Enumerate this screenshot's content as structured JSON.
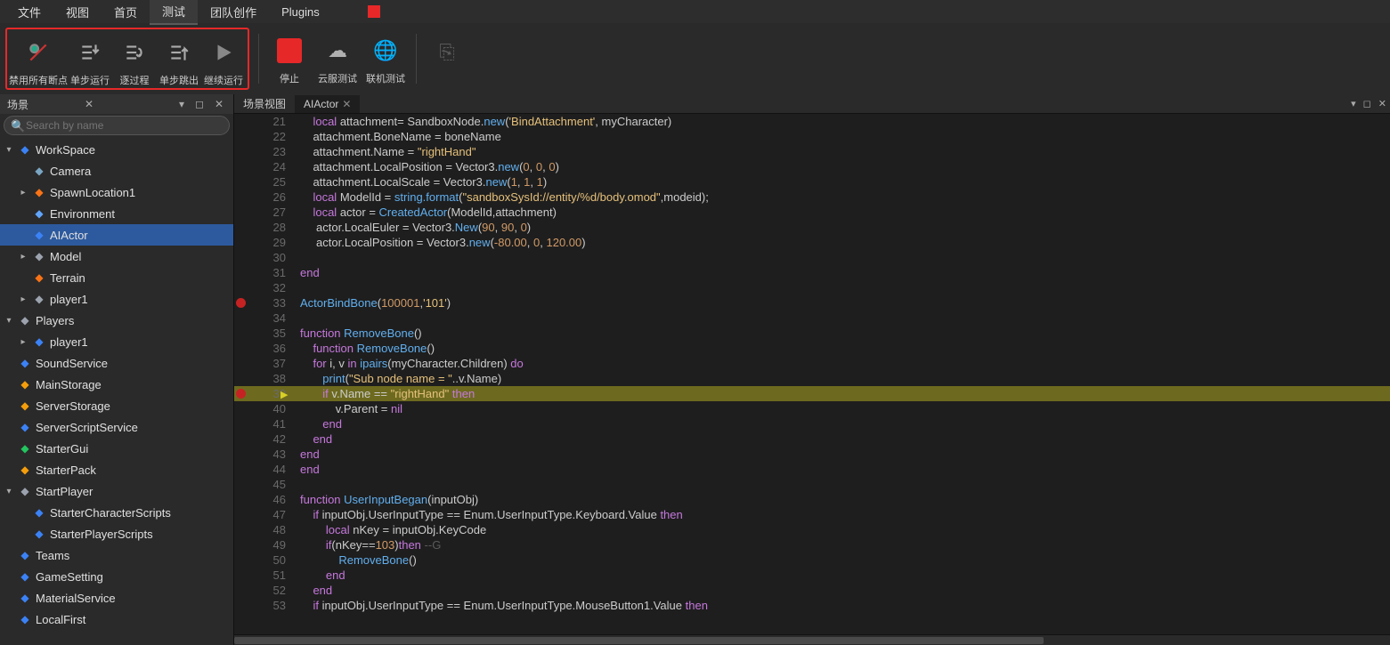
{
  "menubar": {
    "items": [
      "文件",
      "视图",
      "首页",
      "测试",
      "团队创作",
      "Plugins"
    ],
    "activeIndex": 3
  },
  "toolbar": {
    "debug": [
      {
        "name": "disable-breakpoints",
        "label": "禁用所有断点",
        "icon": "bp"
      },
      {
        "name": "step-run",
        "label": "单步运行",
        "icon": "stepinto"
      },
      {
        "name": "step-over",
        "label": "逐过程",
        "icon": "stepover"
      },
      {
        "name": "step-out",
        "label": "单步跳出",
        "icon": "stepout"
      },
      {
        "name": "continue",
        "label": "继续运行",
        "icon": "play"
      }
    ],
    "stop": {
      "label": "停止"
    },
    "cloud": {
      "label": "云服测试"
    },
    "net": {
      "label": "联机测试"
    }
  },
  "scenePanel": {
    "title": "场景",
    "search_placeholder": "Search by name"
  },
  "tree": [
    {
      "label": "WorkSpace",
      "icon": "globe",
      "arrow": "down",
      "indent": 0,
      "color": "#3b82f6"
    },
    {
      "label": "Camera",
      "icon": "cam",
      "indent": 1,
      "color": "#7aa6c4"
    },
    {
      "label": "SpawnLocation1",
      "icon": "spawn",
      "arrow": "right",
      "indent": 1,
      "color": "#f97316"
    },
    {
      "label": "Environment",
      "icon": "env",
      "indent": 1,
      "color": "#60a5fa"
    },
    {
      "label": "AIActor",
      "icon": "script",
      "indent": 1,
      "selected": true,
      "color": "#3b82f6"
    },
    {
      "label": "Model",
      "icon": "model",
      "arrow": "right",
      "indent": 1,
      "color": "#9ca3af"
    },
    {
      "label": "Terrain",
      "icon": "terrain",
      "indent": 1,
      "color": "#f97316"
    },
    {
      "label": "player1",
      "icon": "player",
      "arrow": "right",
      "indent": 1,
      "color": "#9ca3af"
    },
    {
      "label": "Players",
      "icon": "players",
      "arrow": "down",
      "indent": 0,
      "color": "#9ca3af"
    },
    {
      "label": "player1",
      "icon": "player",
      "arrow": "right",
      "indent": 1,
      "color": "#3b82f6"
    },
    {
      "label": "SoundService",
      "icon": "sound",
      "indent": 0,
      "color": "#3b82f6"
    },
    {
      "label": "MainStorage",
      "icon": "storage",
      "indent": 0,
      "color": "#f59e0b"
    },
    {
      "label": "ServerStorage",
      "icon": "storage",
      "indent": 0,
      "color": "#f59e0b"
    },
    {
      "label": "ServerScriptService",
      "icon": "script",
      "indent": 0,
      "color": "#3b82f6"
    },
    {
      "label": "StarterGui",
      "icon": "gui",
      "indent": 0,
      "color": "#22c55e"
    },
    {
      "label": "StarterPack",
      "icon": "pack",
      "indent": 0,
      "color": "#f59e0b"
    },
    {
      "label": "StartPlayer",
      "icon": "player",
      "arrow": "down",
      "indent": 0,
      "color": "#9ca3af"
    },
    {
      "label": "StarterCharacterScripts",
      "icon": "script",
      "indent": 1,
      "color": "#3b82f6"
    },
    {
      "label": "StarterPlayerScripts",
      "icon": "script",
      "indent": 1,
      "color": "#3b82f6"
    },
    {
      "label": "Teams",
      "icon": "teams",
      "indent": 0,
      "color": "#3b82f6"
    },
    {
      "label": "GameSetting",
      "icon": "gear",
      "indent": 0,
      "color": "#3b82f6"
    },
    {
      "label": "MaterialService",
      "icon": "mat",
      "indent": 0,
      "color": "#3b82f6"
    },
    {
      "label": "LocalFirst",
      "icon": "local",
      "indent": 0,
      "color": "#3b82f6"
    }
  ],
  "editorTabs": {
    "sceneView": "场景视图",
    "activeTab": "AIActor"
  },
  "code": [
    {
      "n": 21,
      "t": [
        [
          "",
          "    "
        ],
        [
          "kw",
          "local"
        ],
        [
          "",
          " attachment= SandboxNode."
        ],
        [
          "fn",
          "new"
        ],
        [
          "",
          "("
        ],
        [
          "str",
          "'BindAttachment'"
        ],
        [
          "",
          ", myCharacter)"
        ]
      ]
    },
    {
      "n": 22,
      "t": [
        [
          "",
          "    attachment.BoneName = boneName"
        ]
      ]
    },
    {
      "n": 23,
      "t": [
        [
          "",
          "    attachment.Name = "
        ],
        [
          "str",
          "\"rightHand\""
        ]
      ]
    },
    {
      "n": 24,
      "t": [
        [
          "",
          "    attachment.LocalPosition = Vector3."
        ],
        [
          "fn",
          "new"
        ],
        [
          "",
          "("
        ],
        [
          "num",
          "0"
        ],
        [
          "",
          ", "
        ],
        [
          "num",
          "0"
        ],
        [
          "",
          ", "
        ],
        [
          "num",
          "0"
        ],
        [
          "",
          ")"
        ]
      ]
    },
    {
      "n": 25,
      "t": [
        [
          "",
          "    attachment.LocalScale = Vector3."
        ],
        [
          "fn",
          "new"
        ],
        [
          "",
          "("
        ],
        [
          "num",
          "1"
        ],
        [
          "",
          ", "
        ],
        [
          "num",
          "1"
        ],
        [
          "",
          ", "
        ],
        [
          "num",
          "1"
        ],
        [
          "",
          ")"
        ]
      ]
    },
    {
      "n": 26,
      "t": [
        [
          "",
          "    "
        ],
        [
          "kw",
          "local"
        ],
        [
          "",
          " ModelId = "
        ],
        [
          "fn",
          "string.format"
        ],
        [
          "",
          "("
        ],
        [
          "str",
          "\"sandboxSysId://entity/%d/body.omod\""
        ],
        [
          "",
          ",modeid);"
        ]
      ]
    },
    {
      "n": 27,
      "t": [
        [
          "",
          "    "
        ],
        [
          "kw",
          "local"
        ],
        [
          "",
          " actor = "
        ],
        [
          "fn",
          "CreatedActor"
        ],
        [
          "",
          "(ModelId,attachment)"
        ]
      ]
    },
    {
      "n": 28,
      "t": [
        [
          "",
          "     actor.LocalEuler = Vector3."
        ],
        [
          "fn",
          "New"
        ],
        [
          "",
          "("
        ],
        [
          "num",
          "90"
        ],
        [
          "",
          ", "
        ],
        [
          "num",
          "90"
        ],
        [
          "",
          ", "
        ],
        [
          "num",
          "0"
        ],
        [
          "",
          ")"
        ]
      ]
    },
    {
      "n": 29,
      "t": [
        [
          "",
          "     actor.LocalPosition = Vector3."
        ],
        [
          "fn",
          "new"
        ],
        [
          "",
          "("
        ],
        [
          "num",
          "-80.00"
        ],
        [
          "",
          ", "
        ],
        [
          "num",
          "0"
        ],
        [
          "",
          ", "
        ],
        [
          "num",
          "120.00"
        ],
        [
          "",
          ")"
        ]
      ]
    },
    {
      "n": 30,
      "t": [
        [
          "",
          ""
        ]
      ]
    },
    {
      "n": 31,
      "t": [
        [
          "kw",
          "end"
        ]
      ]
    },
    {
      "n": 32,
      "t": [
        [
          "",
          ""
        ]
      ]
    },
    {
      "n": 33,
      "bp": true,
      "t": [
        [
          "fn",
          "ActorBindBone"
        ],
        [
          "",
          "("
        ],
        [
          "num",
          "100001"
        ],
        [
          "",
          ","
        ],
        [
          "str",
          "'101'"
        ],
        [
          "",
          ")"
        ]
      ]
    },
    {
      "n": 34,
      "t": [
        [
          "",
          ""
        ]
      ]
    },
    {
      "n": 35,
      "t": [
        [
          "kw",
          "function"
        ],
        [
          "",
          " "
        ],
        [
          "fn",
          "RemoveBone"
        ],
        [
          "",
          "()"
        ]
      ]
    },
    {
      "n": 36,
      "t": [
        [
          "",
          "    "
        ],
        [
          "kw",
          "function"
        ],
        [
          "",
          " "
        ],
        [
          "fn",
          "RemoveBone"
        ],
        [
          "",
          "()"
        ]
      ]
    },
    {
      "n": 37,
      "t": [
        [
          "",
          "    "
        ],
        [
          "kw",
          "for"
        ],
        [
          "",
          " i, v "
        ],
        [
          "kw",
          "in"
        ],
        [
          "",
          " "
        ],
        [
          "fn",
          "ipairs"
        ],
        [
          "",
          "(myCharacter.Children) "
        ],
        [
          "kw",
          "do"
        ]
      ]
    },
    {
      "n": 38,
      "t": [
        [
          "",
          "       "
        ],
        [
          "fn",
          "print"
        ],
        [
          "",
          "("
        ],
        [
          "str",
          "\"Sub node name = \""
        ],
        [
          "",
          "..v.Name)"
        ]
      ]
    },
    {
      "n": 39,
      "bp": true,
      "current": true,
      "arrow": true,
      "t": [
        [
          "",
          "       "
        ],
        [
          "kw",
          "if"
        ],
        [
          "",
          " v.Name == "
        ],
        [
          "str",
          "\"rightHand\""
        ],
        [
          "",
          " "
        ],
        [
          "kw",
          "then"
        ]
      ]
    },
    {
      "n": 40,
      "t": [
        [
          "",
          "           v.Parent = "
        ],
        [
          "kw",
          "nil"
        ]
      ]
    },
    {
      "n": 41,
      "t": [
        [
          "",
          "       "
        ],
        [
          "kw",
          "end"
        ]
      ]
    },
    {
      "n": 42,
      "t": [
        [
          "",
          "    "
        ],
        [
          "kw",
          "end"
        ]
      ]
    },
    {
      "n": 43,
      "t": [
        [
          "kw",
          "end"
        ]
      ]
    },
    {
      "n": 44,
      "t": [
        [
          "kw",
          "end"
        ]
      ]
    },
    {
      "n": 45,
      "t": [
        [
          "",
          ""
        ]
      ]
    },
    {
      "n": 46,
      "t": [
        [
          "kw",
          "function"
        ],
        [
          "",
          " "
        ],
        [
          "fn",
          "UserInputBegan"
        ],
        [
          "",
          "(inputObj)"
        ]
      ]
    },
    {
      "n": 47,
      "t": [
        [
          "",
          "    "
        ],
        [
          "kw",
          "if"
        ],
        [
          "",
          " inputObj.UserInputType == Enum.UserInputType.Keyboard.Value "
        ],
        [
          "kw",
          "then"
        ]
      ]
    },
    {
      "n": 48,
      "t": [
        [
          "",
          "        "
        ],
        [
          "kw",
          "local"
        ],
        [
          "",
          " nKey = inputObj.KeyCode"
        ]
      ]
    },
    {
      "n": 49,
      "t": [
        [
          "",
          "        "
        ],
        [
          "kw",
          "if"
        ],
        [
          "",
          "(nKey=="
        ],
        [
          "num",
          "103"
        ],
        [
          "",
          ")"
        ],
        [
          "kw",
          "then"
        ],
        [
          "",
          " "
        ],
        [
          "cm",
          "--G"
        ]
      ]
    },
    {
      "n": 50,
      "t": [
        [
          "",
          "            "
        ],
        [
          "fn",
          "RemoveBone"
        ],
        [
          "",
          "()"
        ]
      ]
    },
    {
      "n": 51,
      "t": [
        [
          "",
          "        "
        ],
        [
          "kw",
          "end"
        ]
      ]
    },
    {
      "n": 52,
      "t": [
        [
          "",
          "    "
        ],
        [
          "kw",
          "end"
        ]
      ]
    },
    {
      "n": 53,
      "t": [
        [
          "",
          "    "
        ],
        [
          "kw",
          "if"
        ],
        [
          "",
          " inputObj.UserInputType == Enum.UserInputType.MouseButton1.Value "
        ],
        [
          "kw",
          "then"
        ]
      ]
    }
  ]
}
